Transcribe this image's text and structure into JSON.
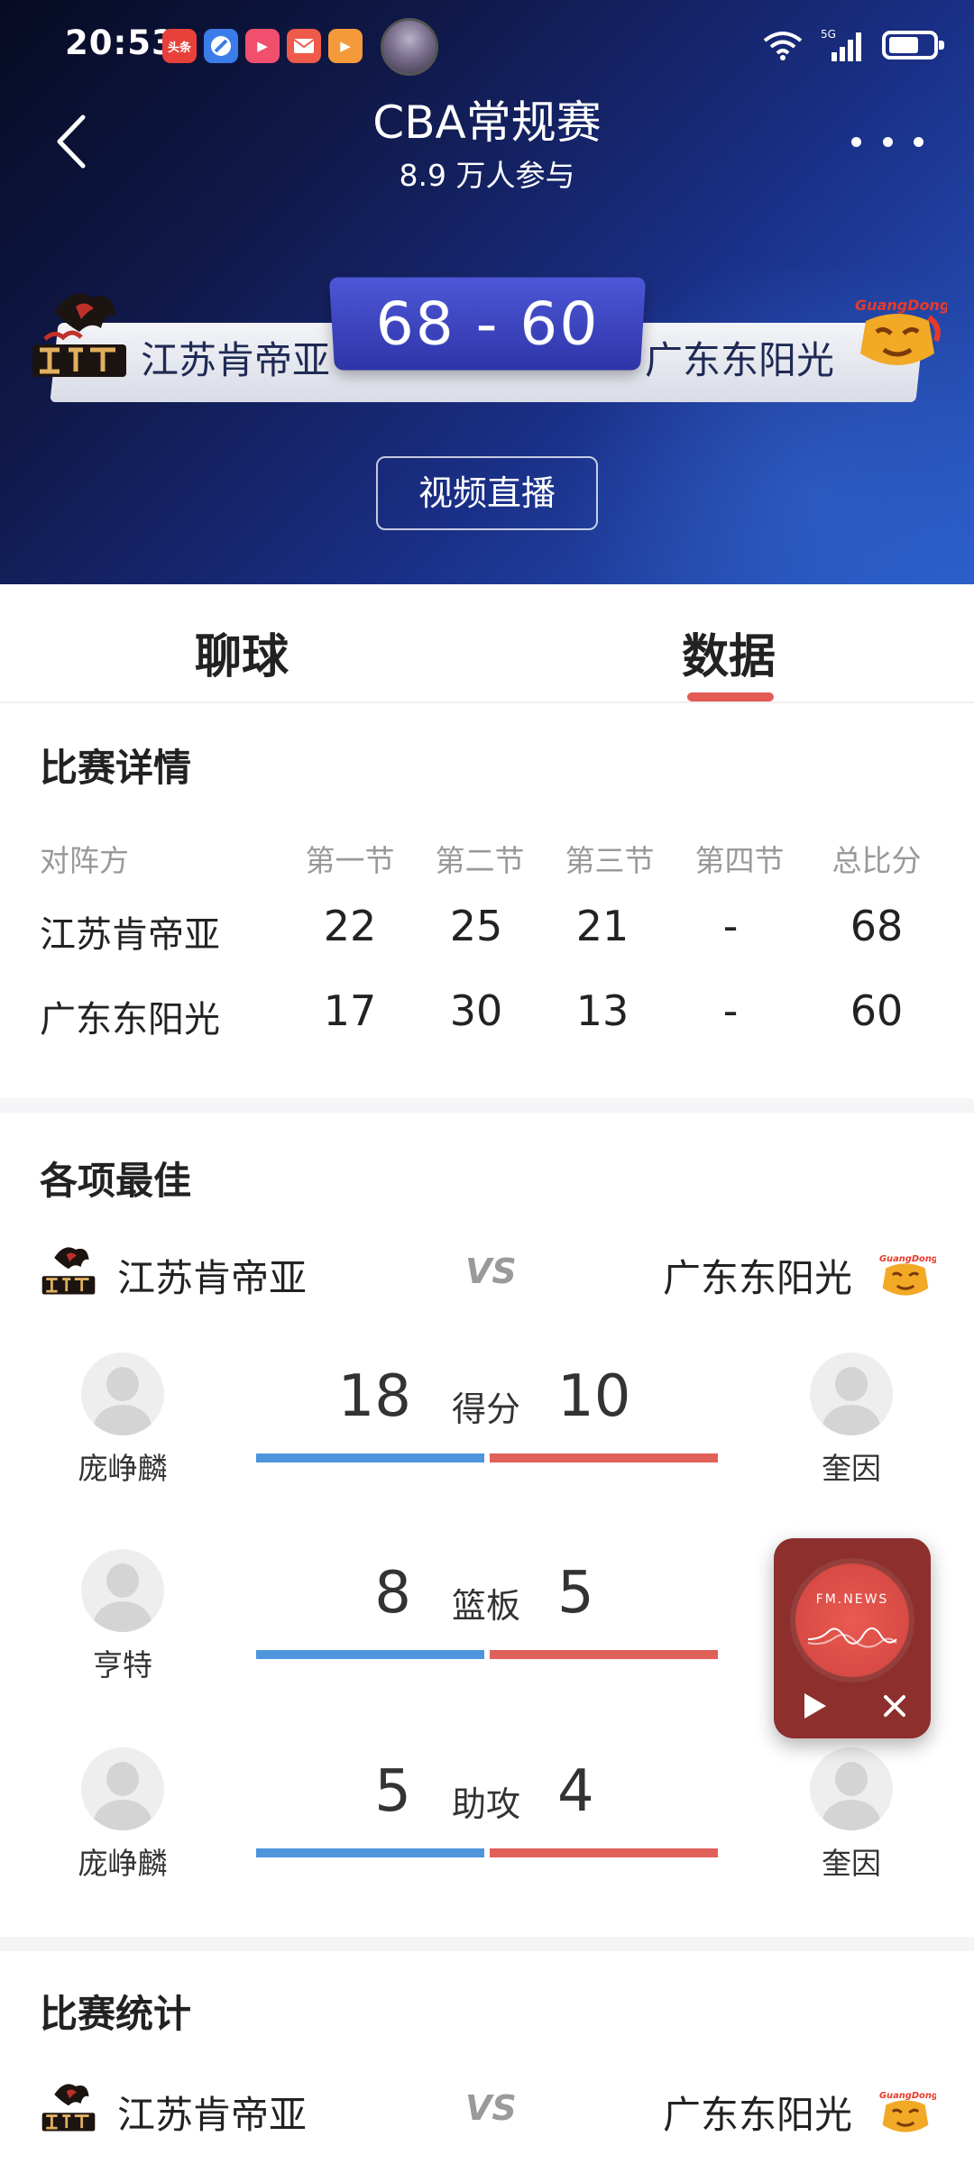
{
  "status_bar": {
    "time": "20:53",
    "app_icons": [
      {
        "name": "toutiao-icon",
        "label": "头条",
        "color": "#e8413b"
      },
      {
        "name": "browser-icon",
        "label": "",
        "color": "#3b7de8"
      },
      {
        "name": "video-app-icon",
        "label": "▶",
        "color": "#f0506e"
      },
      {
        "name": "mail-app-icon",
        "label": "",
        "color": "#f05a4a"
      },
      {
        "name": "media-app-icon",
        "label": "▶",
        "color": "#f59a3a"
      }
    ],
    "network": "5G"
  },
  "header": {
    "title": "CBA常规赛",
    "participants": "8.9 万人参与",
    "score": "68 - 60",
    "team_home": "江苏肯帝亚",
    "team_away": "广东东阳光",
    "video_button": "视频直播",
    "gradient_colors": [
      "#070b22",
      "#2a5cc8"
    ]
  },
  "tabs": [
    {
      "label": "聊球",
      "active": false
    },
    {
      "label": "数据",
      "active": true
    }
  ],
  "accent_color": "#e45a55",
  "match_details": {
    "title": "比赛详情",
    "headers": [
      "对阵方",
      "第一节",
      "第二节",
      "第三节",
      "第四节",
      "总比分"
    ],
    "rows": [
      {
        "team": "江苏肯帝亚",
        "q1": "22",
        "q2": "25",
        "q3": "21",
        "q4": "-",
        "total": "68"
      },
      {
        "team": "广东东阳光",
        "q1": "17",
        "q2": "30",
        "q3": "13",
        "q4": "-",
        "total": "60"
      }
    ]
  },
  "best_players": {
    "title": "各项最佳",
    "team_home": "江苏肯帝亚",
    "team_away": "广东东阳光",
    "vs": "VS",
    "categories": [
      {
        "label": "得分",
        "home_player": "庞峥麟",
        "home_value": "18",
        "away_player": "奎因",
        "away_value": "10"
      },
      {
        "label": "篮板",
        "home_player": "亨特",
        "home_value": "8",
        "away_player": "",
        "away_value": "5"
      },
      {
        "label": "助攻",
        "home_player": "庞峥麟",
        "home_value": "5",
        "away_player": "奎因",
        "away_value": "4"
      }
    ],
    "bar_colors": {
      "home": "#4f95dc",
      "away": "#e0605a"
    }
  },
  "game_stats": {
    "title": "比赛统计",
    "team_home": "江苏肯帝亚",
    "team_away": "广东东阳光",
    "vs": "VS"
  },
  "floating_player": {
    "brand": "FM.NEWS"
  }
}
